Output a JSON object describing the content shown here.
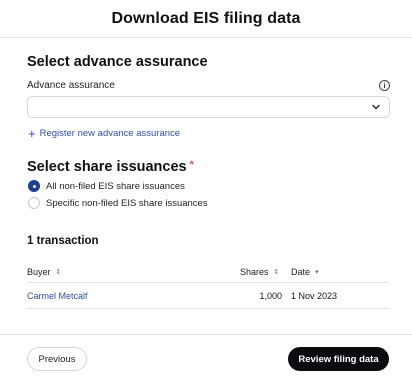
{
  "header": {
    "title": "Download EIS filing data"
  },
  "advance": {
    "section_title": "Select advance assurance",
    "field_label": "Advance assurance",
    "field_value": "",
    "info_icon": "info-icon",
    "chevron_icon": "chevron-down-icon",
    "register_label": "Register new advance assurance"
  },
  "issuances": {
    "section_title": "Select share issuances",
    "required_marker": "*",
    "options": [
      {
        "label": "All non-filed EIS share issuances",
        "checked": true
      },
      {
        "label": "Specific non-filed EIS share issuances",
        "checked": false
      }
    ]
  },
  "transactions": {
    "count_label": "1 transaction",
    "columns": [
      {
        "label": "Buyer",
        "sort_icon": "⇕"
      },
      {
        "label": "Shares",
        "sort_icon": "⇕"
      },
      {
        "label": "Date",
        "sort_icon": "▾"
      }
    ],
    "rows": [
      {
        "buyer": "Carmel Metcalf",
        "shares": "1,000",
        "date": "1 Nov 2023"
      }
    ]
  },
  "footer": {
    "previous_label": "Previous",
    "review_label": "Review filing data"
  },
  "colors": {
    "primary": "#1d3f91",
    "link": "#2d4fa3",
    "required": "#d9534f",
    "dark_button": "#0b0b10"
  }
}
